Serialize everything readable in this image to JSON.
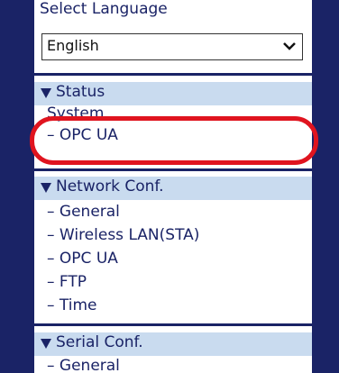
{
  "language": {
    "title": "Select Language",
    "selected": "English"
  },
  "status": {
    "title": "Status",
    "items": [
      "System",
      "OPC UA"
    ]
  },
  "network": {
    "title": "Network Conf.",
    "items": [
      "General",
      "Wireless LAN(STA)",
      "OPC UA",
      "FTP",
      "Time"
    ]
  },
  "serial": {
    "title": "Serial Conf.",
    "items": [
      "General"
    ]
  },
  "colors": {
    "frame": "#1a2366",
    "section_header": "#c9dbef",
    "highlight": "#e0141f"
  },
  "icons": {
    "collapse": "triangle-down-icon",
    "dropdown": "chevron-down-icon"
  }
}
